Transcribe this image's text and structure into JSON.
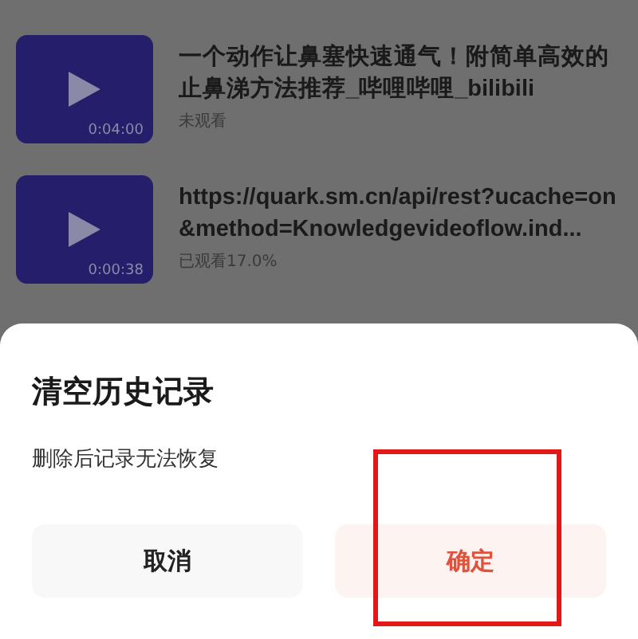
{
  "history": [
    {
      "title": "一个动作让鼻塞快速通气！附简单高效的止鼻涕方法推荐_哔哩哔哩_bilibili",
      "duration": "0:04:00",
      "progress": "未观看"
    },
    {
      "title": "https://quark.sm.cn/api/rest?ucache=on&method=Knowledgevideoflow.ind...",
      "duration": "0:00:38",
      "progress": "已观看17.0%"
    }
  ],
  "dialog": {
    "title": "清空历史记录",
    "message": "删除后记录无法恢复",
    "buttons": [
      {
        "label": "取消",
        "kind": "cancel",
        "highlighted": false
      },
      {
        "label": "确定",
        "kind": "confirm",
        "highlighted": true
      }
    ]
  }
}
